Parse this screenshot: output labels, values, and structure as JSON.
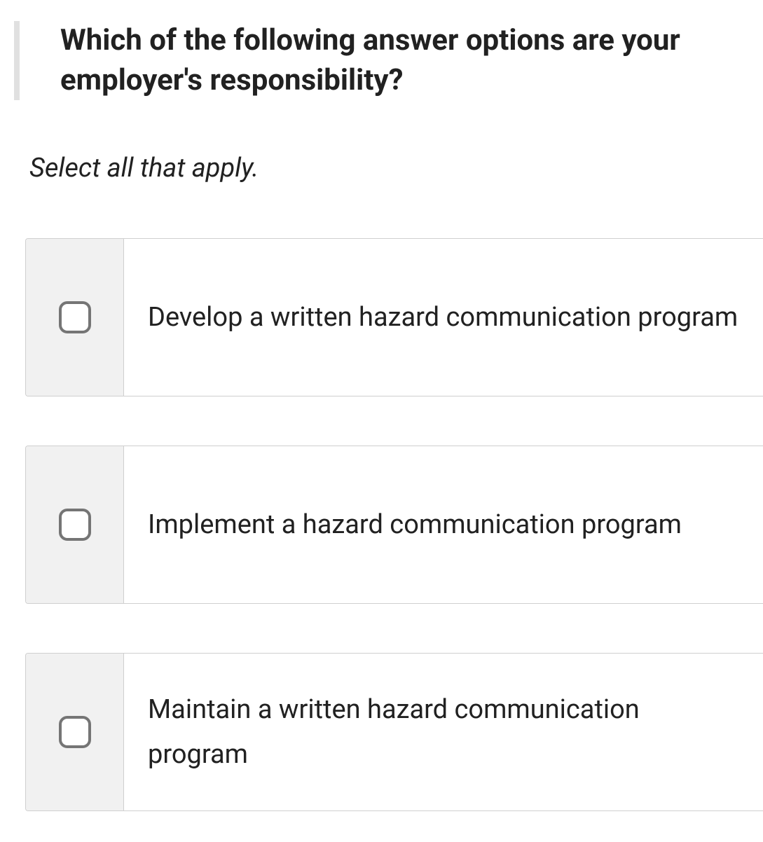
{
  "question": "Which of the following answer options are your employer's responsibility?",
  "instruction": "Select all that apply.",
  "options": [
    {
      "label": "Develop a written hazard communication program"
    },
    {
      "label": "Implement a hazard communication program"
    },
    {
      "label": "Maintain a written hazard communication program"
    }
  ]
}
